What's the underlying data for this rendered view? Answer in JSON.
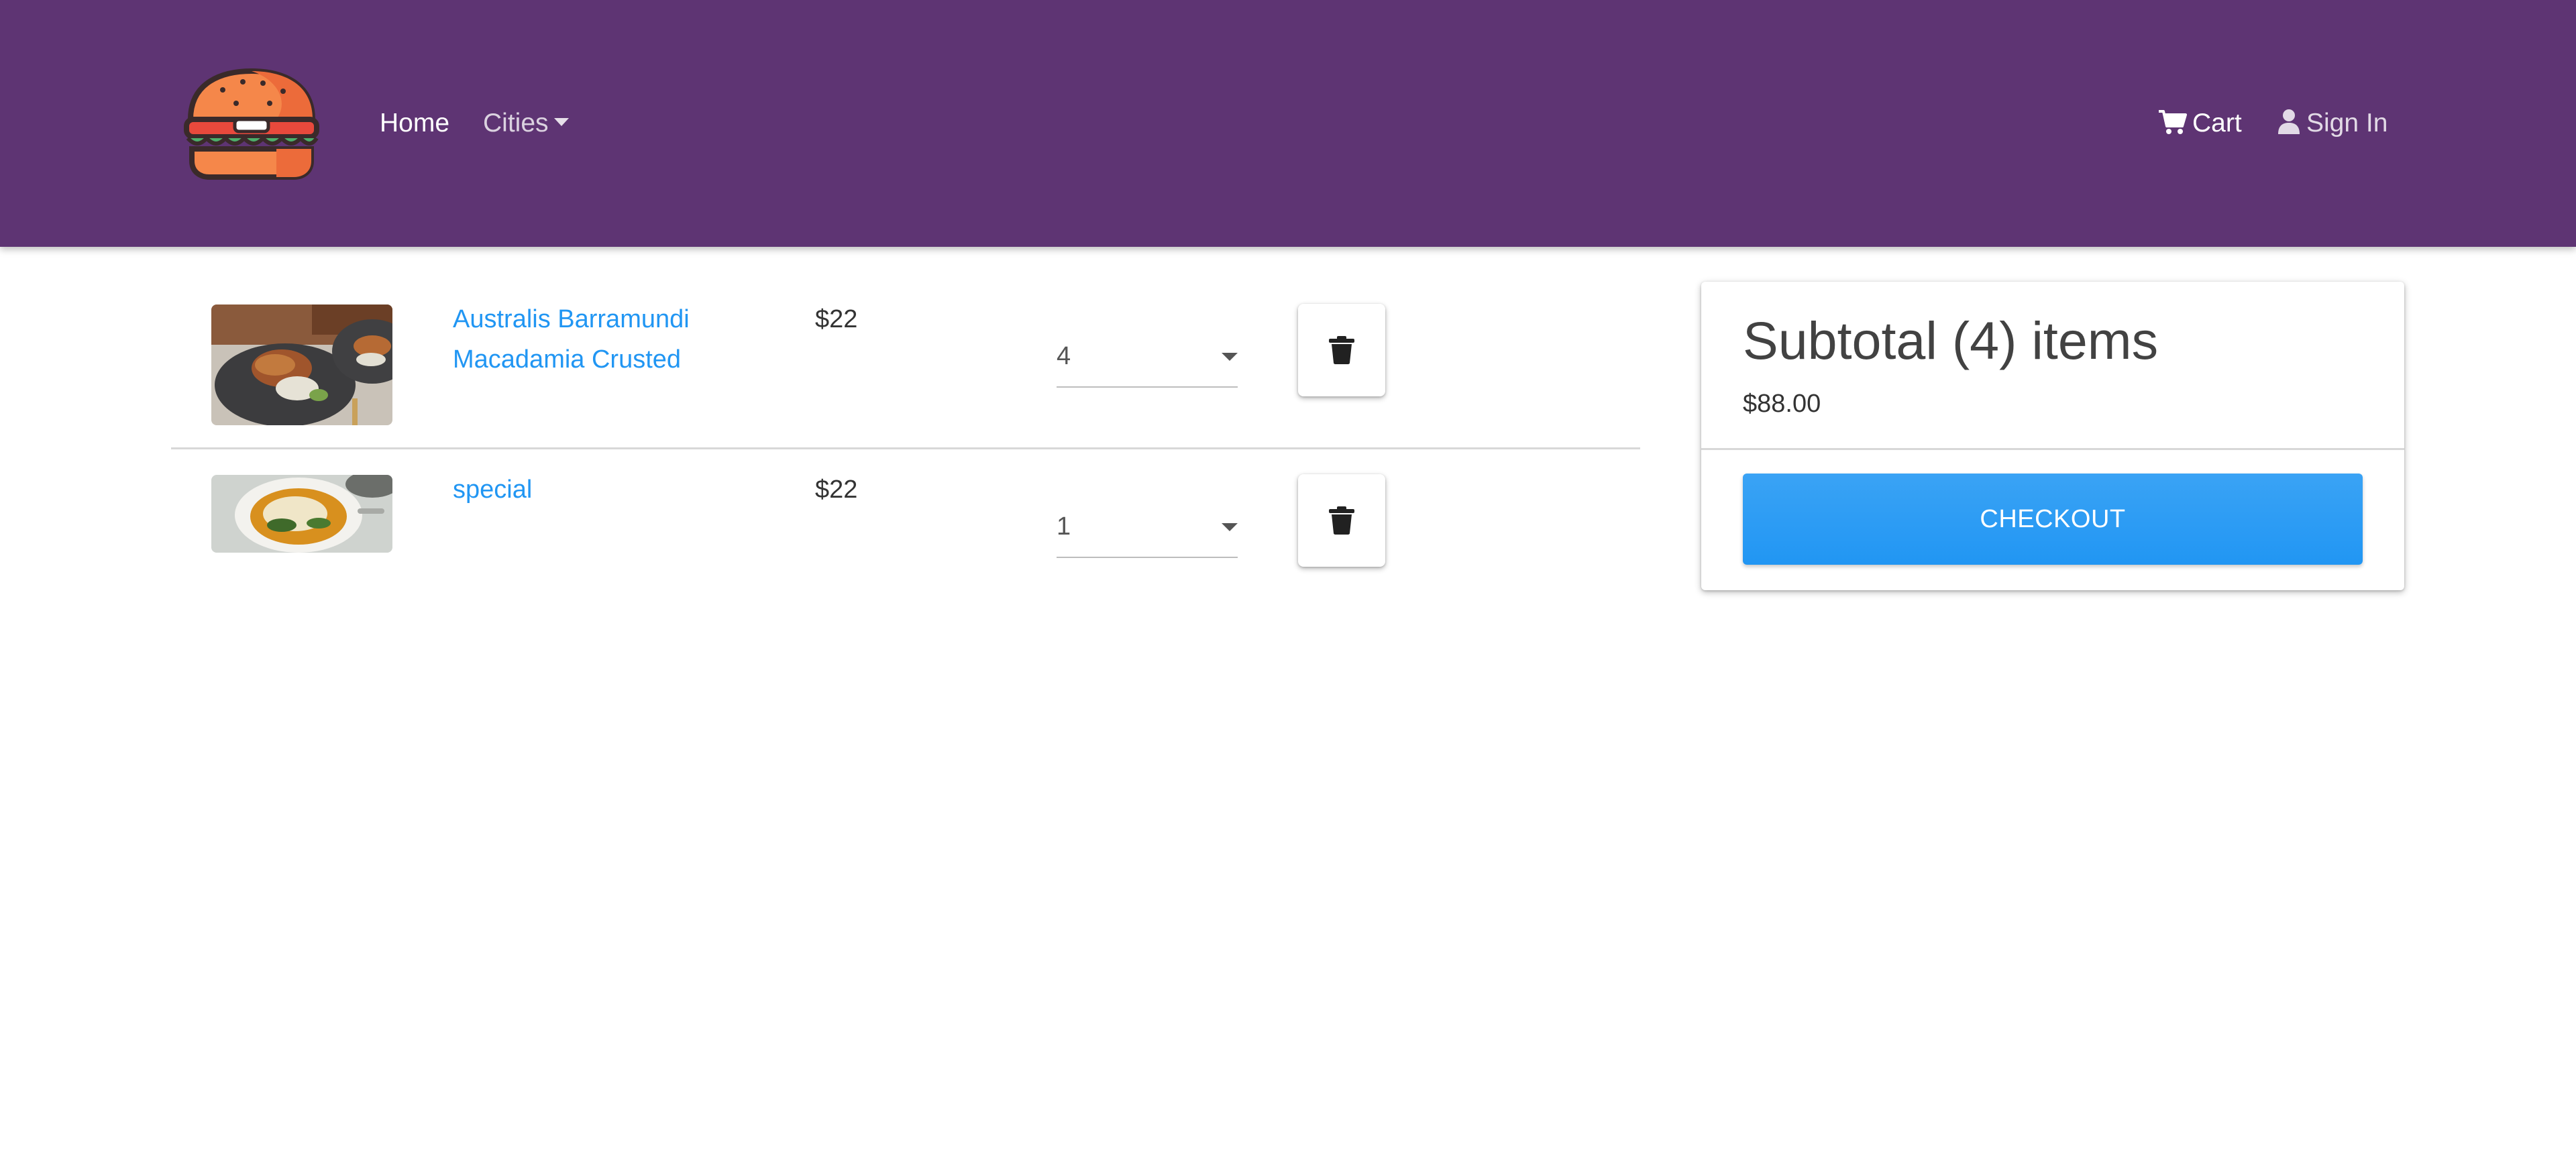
{
  "navbar": {
    "home_label": "Home",
    "cities_label": "Cities",
    "cart_label": "Cart",
    "signin_label": "Sign In",
    "background": "#5e3473",
    "logo_icon": "burger-logo"
  },
  "cart": {
    "items": [
      {
        "name": "Australis Barramundi Macadamia Crusted",
        "price": "$22",
        "quantity": "4",
        "image": "plated barramundi fish dish",
        "delete_icon": "trash-icon"
      },
      {
        "name": "special",
        "price": "$22",
        "quantity": "1",
        "image": "bowl of fish stew",
        "delete_icon": "trash-icon"
      }
    ]
  },
  "summary": {
    "title": "Subtotal (4) items",
    "total": "$88.00",
    "checkout_label": "CHECKOUT"
  },
  "colors": {
    "accent": "#2196f3",
    "navbar": "#5e3473"
  }
}
